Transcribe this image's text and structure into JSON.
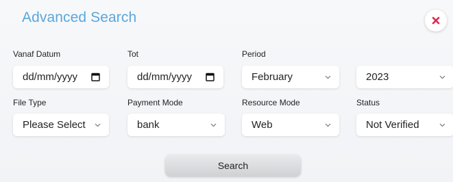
{
  "dialog": {
    "title": "Advanced Search",
    "close_icon": "close-x-icon",
    "close_color": "#e02850",
    "title_color": "#5aa6dc"
  },
  "row1": {
    "vanaf": {
      "label": "Vanaf Datum",
      "value": "dd/mm/yyyy",
      "icon": "calendar-icon"
    },
    "tot": {
      "label": "Tot",
      "value": "dd/mm/yyyy",
      "icon": "calendar-icon"
    },
    "period": {
      "label": "Period",
      "value": "February"
    },
    "year": {
      "value": "2023"
    }
  },
  "row2": {
    "file_type": {
      "label": "File Type",
      "value": "Please Select"
    },
    "payment_mode": {
      "label": "Payment Mode",
      "value": "bank"
    },
    "resource_mode": {
      "label": "Resource Mode",
      "value": "Web"
    },
    "status": {
      "label": "Status",
      "value": "Not Verified"
    }
  },
  "search_button": {
    "label": "Search"
  }
}
